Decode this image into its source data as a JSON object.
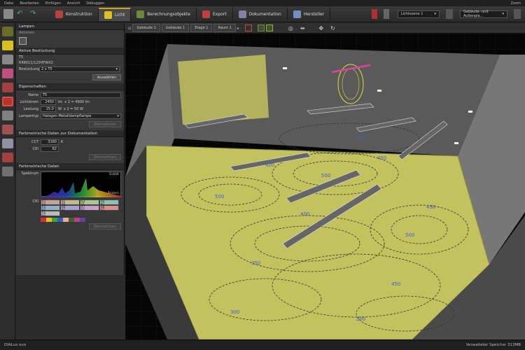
{
  "menu": [
    "Datei",
    "Bearbeiten",
    "Einfügen",
    "Ansicht",
    "Debuggen"
  ],
  "menu_right": "Zoom",
  "tabs": [
    {
      "label": "Konstruktion",
      "color": "#b84040"
    },
    {
      "label": "Licht",
      "color": "#e0c020"
    },
    {
      "label": "Berechnungsobjekte",
      "color": "#6a8a3a"
    },
    {
      "label": "Export",
      "color": "#c04040"
    },
    {
      "label": "Dokumentation",
      "color": "#8080a0"
    },
    {
      "label": "Hersteller",
      "color": "#7090c0"
    }
  ],
  "toolbar_right": {
    "lightscene": "Lichtszene 1",
    "view": "Gebäude- und Außenpla..."
  },
  "panel": {
    "head": "Lampen",
    "actions": "Aktionen",
    "active_header": "Aktive Bestückung",
    "lamp_type": "T5",
    "lamp_code": "R48011/125HFWX2",
    "bestueckung_label": "Bestückung",
    "bestueckung_value": "2 x T5",
    "select_button": "Auswählen",
    "props_header": "Eigenschaften",
    "name_label": "Name",
    "name_value": "T5",
    "flux_label": "Lichtstrom",
    "flux_value": "2450",
    "flux_unit": "lm",
    "flux_total": "x 2 = 4900 lm",
    "power_label": "Leistung",
    "power_value": "25.0",
    "power_unit": "W",
    "power_total": "x 2 = 50 W",
    "lamptype_label": "Lampentyp",
    "lamptype_value": "Halogen-Metalldampflampe",
    "button_dim": "Übernehmen",
    "color_doc_header": "Farbmetrische Daten zur Dokumentation",
    "cct_label": "CCT",
    "cct_value": "3160",
    "cct_unit": "K",
    "cri_label": "CRI",
    "cri_value": "82",
    "button_dim2": "Übernehmen",
    "color_header": "Farbmetrische Daten",
    "spectrum_label": "Spektrum",
    "spectrum_cct": "3160K",
    "spectrum_action": "Ändern",
    "cri_grid_label": "CRI",
    "cri_cells": [
      "R1\n84",
      "R2\n89",
      "R3\n91",
      "R4\n82",
      "R5\n83",
      "R6\n82",
      "R7\n87",
      "R8\n67",
      "Ra\n82"
    ],
    "button_dim3": "Übernehmen"
  },
  "viewport_breadcrumb": [
    "Gebäude 1",
    "Gebäude 1",
    "Etage 1",
    "Raum 1"
  ],
  "contour_labels": [
    "500",
    "500",
    "450",
    "400",
    "350",
    "300",
    "200",
    "500",
    "450",
    "400",
    "350",
    "450"
  ],
  "status": {
    "left": "DIALux evo",
    "right": "Verwalteter Speicher 313MB"
  }
}
